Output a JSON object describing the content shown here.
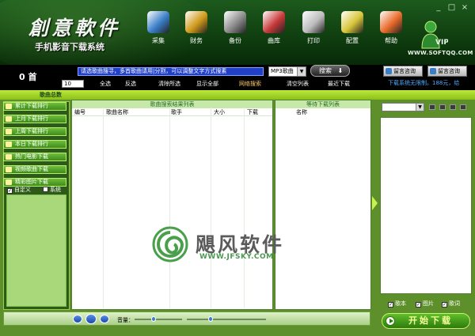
{
  "header": {
    "logo_main": "創意軟件",
    "logo_sub": "手机影音下载系统",
    "site_url": "WWW.SOFTQQ.COM",
    "window_controls": [
      "_",
      "□",
      "×"
    ],
    "toolbar": [
      {
        "label": "采集",
        "icon": "collect-icon",
        "color": "#3a7ec8"
      },
      {
        "label": "财务",
        "icon": "finance-icon",
        "color": "#d09a1a"
      },
      {
        "label": "备份",
        "icon": "backup-icon",
        "color": "#8a8a8a"
      },
      {
        "label": "曲库",
        "icon": "library-icon",
        "color": "#c83a3a"
      },
      {
        "label": "打印",
        "icon": "printer-icon",
        "color": "#bcbcbc"
      },
      {
        "label": "配置",
        "icon": "config-icon",
        "color": "#d8c63a"
      },
      {
        "label": "帮助",
        "icon": "help-icon",
        "color": "#e86a2a"
      }
    ],
    "vip_label": "VIP"
  },
  "search": {
    "count": "0 首",
    "query": "请选歌曲搜寻，多首歌曲请用|分割，可以调整文字方式搜素",
    "type": "MP3歌曲",
    "button": "搜索",
    "page": "10",
    "links": [
      {
        "label": "全选"
      },
      {
        "label": "反选"
      },
      {
        "label": "清除所选"
      },
      {
        "label": "显示全部"
      },
      {
        "label": "网络搜索",
        "highlight": true
      },
      {
        "label": "清空列表"
      },
      {
        "label": "最近下载"
      }
    ],
    "feedback_buttons": [
      "留言咨询",
      "留言咨询"
    ],
    "status": "下载系统无限制。188元，给"
  },
  "tab": "歌曲总数",
  "sidebar": {
    "items": [
      "累计下载排行",
      "上月下载排行",
      "上周下载排行",
      "本日下载排行",
      "热门电影下载",
      "视频歌曲下载",
      "精彩图片下载"
    ],
    "checks": [
      {
        "label": "自定义",
        "checked": true
      },
      {
        "label": "系统",
        "checked": false
      }
    ]
  },
  "results": {
    "caption": "歌曲搜索结果列表",
    "columns": [
      "编号",
      "歌曲名称",
      "歌手",
      "大小",
      "下载"
    ]
  },
  "queue": {
    "caption": "等待下载列表",
    "columns": [
      "名称"
    ]
  },
  "right": {
    "checks": [
      {
        "label": "歌本",
        "checked": true
      },
      {
        "label": "图片",
        "checked": true
      },
      {
        "label": "歌词",
        "checked": true
      }
    ],
    "start_button": "开始下载"
  },
  "player": {
    "volume_label": "音量：",
    "volume": 0.4,
    "progress": 0.3
  },
  "watermark": {
    "text": "飓风软件",
    "url": "WWW.JFSKY.COM"
  }
}
